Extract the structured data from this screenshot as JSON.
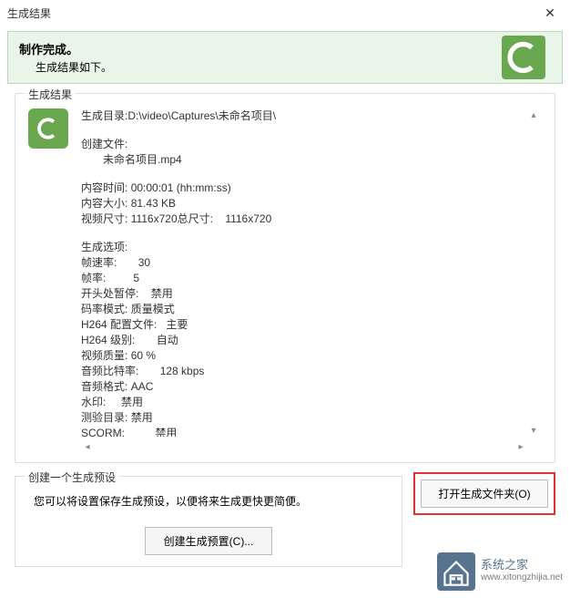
{
  "titlebar": {
    "title": "生成结果"
  },
  "banner": {
    "title": "制作完成。",
    "subtitle": "生成结果如下。"
  },
  "results": {
    "group_label": "生成结果",
    "output_dir_label": "生成目录:",
    "output_dir_value": "D:\\video\\Captures\\未命名项目\\",
    "created_files_label": "创建文件:",
    "created_file_1": "未命名项目.mp4",
    "content_time_label": "内容时间:",
    "content_time_value": "00:00:01 (hh:mm:ss)",
    "content_size_label": "内容大小:",
    "content_size_value": "81.43 KB",
    "video_dim_label": "视频尺寸:",
    "video_dim_value": "1116x720总尺寸:",
    "video_total_dim": "1116x720",
    "options_header": "生成选项:",
    "frame_rate_label": "帧速率:",
    "frame_rate_value": "30",
    "bitrate_label": "帧率:",
    "bitrate_value": "5",
    "pause_start_label": "开头处暂停:",
    "pause_start_value": "禁用",
    "bitrate_mode_label": "码率模式:",
    "bitrate_mode_value": "质量模式",
    "h264_profile_label": "H264 配置文件:",
    "h264_profile_value": "主要",
    "h264_level_label": "H264 级别:",
    "h264_level_value": "自动",
    "video_quality_label": "视频质量:",
    "video_quality_value": "60 %",
    "audio_bitrate_label": "音频比特率:",
    "audio_bitrate_value": "128 kbps",
    "audio_format_label": "音频格式:",
    "audio_format_value": "AAC",
    "watermark_label": "水印:",
    "watermark_value": "禁用",
    "toc_label": "测验目录:",
    "toc_value": "禁用",
    "scorm_label": "SCORM:",
    "scorm_value": "禁用"
  },
  "preset": {
    "group_label": "创建一个生成预设",
    "description": "您可以将设置保存生成预设，以便将来生成更快更简便。",
    "button_label": "创建生成预置(C)..."
  },
  "open_folder": {
    "button_label": "打开生成文件夹(O)"
  },
  "footer_watermark": {
    "line1": "系统之家",
    "line2": "www.xitongzhijia.net"
  }
}
